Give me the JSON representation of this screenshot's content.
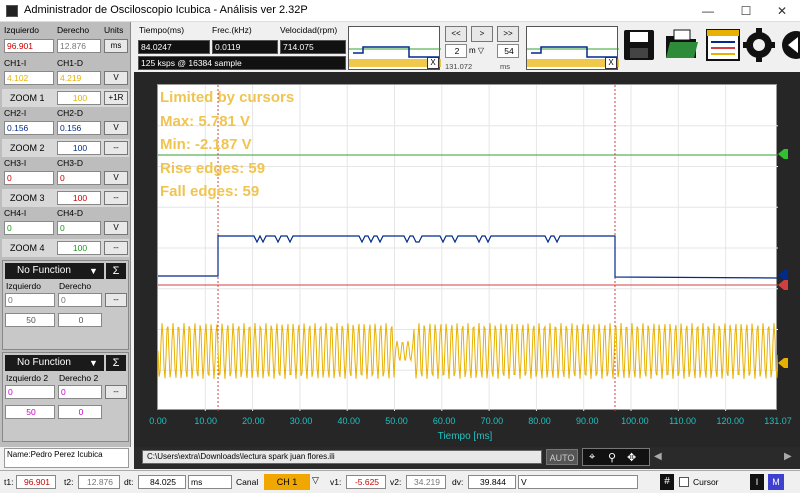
{
  "window": {
    "title": "Administrador de Osciloscopio Icubica - Análisis ver 2.32P",
    "minimize": "—",
    "maximize": "☐",
    "close": "✕"
  },
  "left_panel": {
    "header": {
      "left": "Izquierdo",
      "right": "Derecho",
      "units": "Units"
    },
    "cursor_values": {
      "left": "96.901",
      "right": "12.876",
      "unit": "ms"
    },
    "ch1": {
      "label_left": "CH1-I",
      "label_right": "CH1-D",
      "value_left": "4.102",
      "value_right": "4.219",
      "unit": "V"
    },
    "zoom1": {
      "label": "ZOOM 1",
      "value": "100",
      "btn": "+1R"
    },
    "ch2": {
      "label_left": "CH2-I",
      "label_right": "CH2-D",
      "value_left": "0.156",
      "value_right": "0.156",
      "unit": "V"
    },
    "zoom2": {
      "label": "ZOOM 2",
      "value": "100",
      "btn": "--"
    },
    "ch3": {
      "label_left": "CH3-I",
      "label_right": "CH3-D",
      "value_left": "0",
      "value_right": "0",
      "unit": "V"
    },
    "zoom3": {
      "label": "ZOOM 3",
      "value": "100",
      "btn": "--"
    },
    "ch4": {
      "label_left": "CH4-I",
      "label_right": "CH4-D",
      "value_left": "0",
      "value_right": "0",
      "unit": "V"
    },
    "zoom4": {
      "label": "ZOOM 4",
      "value": "100",
      "btn": "--"
    },
    "func1": {
      "select": "No Function",
      "sigma": "Σ",
      "label_left": "Izquierdo",
      "label_right": "Derecho",
      "value_left": "0",
      "value_right": "0",
      "btn": "--",
      "zoom": "50",
      "zoom_right": "0"
    },
    "func2": {
      "select": "No Function",
      "sigma": "Σ",
      "label_left": "Izquierdo 2",
      "label_right": "Derecho 2",
      "value_left": "0",
      "value_right": "0",
      "btn": "--",
      "zoom": "50",
      "zoom_right": "0"
    },
    "name": "Name:Pedro Perez Icubica"
  },
  "top_panel": {
    "time_label": "Tiempo(ms)",
    "time_value": "84.0247",
    "freq_label": "Frec.(kHz)",
    "freq_value": "0.0119",
    "speed_label": "Velocidad(rpm)",
    "speed_value": "714.075",
    "sample_info": "125 ksps @ 16384 sample",
    "nav": {
      "prev2": "<<",
      "next": ">",
      "next2": ">>",
      "scale_value": "2",
      "scale_unit": "m",
      "scale_right": "54",
      "time_total": "131.072",
      "time_unit": "ms"
    },
    "mini_close": "X"
  },
  "overlay": {
    "line1": "Limited by cursors",
    "line2": "Max: 5.781 V",
    "line3": "Min: -2.187 V",
    "line4": "Rise edges:  59",
    "line5": "Fall edges:  59"
  },
  "axis": {
    "xlabel": "Tiempo [ms]",
    "ticks": [
      "0.00",
      "10.00",
      "20.00",
      "30.00",
      "40.00",
      "50.00",
      "60.00",
      "70.00",
      "80.00",
      "90.00",
      "100.00",
      "110.00",
      "120.00",
      "131.07"
    ]
  },
  "path": {
    "text": "C:\\Users\\extra\\Downloads\\lectura spark juan flores.ili",
    "auto": "AUTO"
  },
  "status": {
    "t1_label": "t1:",
    "t1_value": "96.901",
    "t2_label": "t2:",
    "t2_value": "12.876",
    "dt_label": "dt:",
    "dt_value": "84.025",
    "dt_unit": "ms",
    "canal_label": "Canal",
    "canal_value": "CH 1",
    "v1_label": "v1:",
    "v1_value": "-5.625",
    "v2_label": "v2:",
    "v2_value": "34.219",
    "dv_label": "dv:",
    "dv_value": "39.844",
    "dv_unit": "V",
    "hash": "#",
    "cursor_label": "Cursor",
    "btn1": "I",
    "btn2": "M"
  },
  "colors": {
    "ch1": "#e8b000",
    "ch2": "#002a8c",
    "red_cursor": "#d04040",
    "green_line": "#30a030",
    "overlay": "#f0c450"
  }
}
